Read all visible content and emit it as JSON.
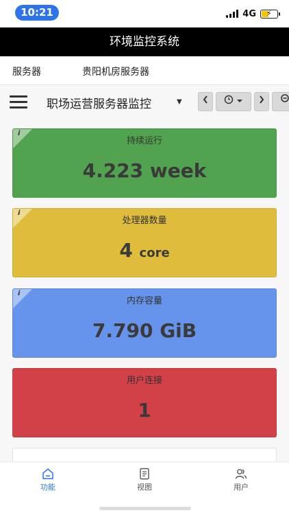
{
  "status_bar": {
    "time": "10:21",
    "network": "4G"
  },
  "header": {
    "title": "环境监控系统"
  },
  "tabs": [
    {
      "label": "服务器"
    },
    {
      "label": "贵阳机房服务器"
    }
  ],
  "dashboard": {
    "title": "职场运营服务器监控"
  },
  "panels": [
    {
      "title": "持续运行",
      "value": "4.223",
      "unit": "week",
      "color": "#52a34f"
    },
    {
      "title": "处理器数量",
      "value": "4",
      "unit": "core",
      "color": "#dfbc3b"
    },
    {
      "title": "内存容量",
      "value": "7.790",
      "unit": "GiB",
      "color": "#6694ec"
    },
    {
      "title": "用户连接",
      "value": "1",
      "unit": "",
      "color": "#d24048"
    }
  ],
  "bottom_nav": [
    {
      "label": "功能",
      "active": true,
      "color": "#2d74e8"
    },
    {
      "label": "视图",
      "active": false,
      "color": "#555555"
    },
    {
      "label": "用户",
      "active": false,
      "color": "#555555"
    }
  ]
}
